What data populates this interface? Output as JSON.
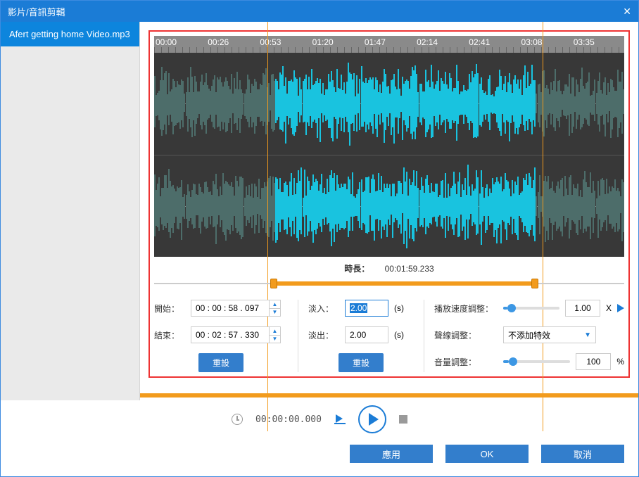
{
  "title": "影片/音訊剪輯",
  "sidebar": {
    "items": [
      {
        "label": "Afert getting home Video.mp3"
      }
    ]
  },
  "ruler": [
    "00:00",
    "00:26",
    "00:53",
    "01:20",
    "01:47",
    "02:14",
    "02:41",
    "03:08",
    "03:35"
  ],
  "selection": {
    "start_pct": 25.5,
    "end_pct": 81.0
  },
  "duration": {
    "label": "時長：",
    "value": "00:01:59.233"
  },
  "range": {
    "start_label": "開始：",
    "start_value": "00 : 00 : 58 . 097",
    "end_label": "結束：",
    "end_value": "00 : 02 : 57 . 330",
    "reset": "重設"
  },
  "fade": {
    "in_label": "淡入：",
    "in_value": "2.00",
    "out_label": "淡出：",
    "out_value": "2.00",
    "unit": "(s)",
    "reset": "重設"
  },
  "speed": {
    "label": "播放速度調整：",
    "value": "1.00",
    "unit": "X",
    "pct": 8
  },
  "curve": {
    "label": "聲線調整：",
    "selected": "不添加特效"
  },
  "volume": {
    "label": "音量調整：",
    "value": "100",
    "unit": "%",
    "pct": 8
  },
  "playback": {
    "time": "00:00:00.000"
  },
  "footer": {
    "apply": "應用",
    "ok": "OK",
    "cancel": "取消"
  }
}
